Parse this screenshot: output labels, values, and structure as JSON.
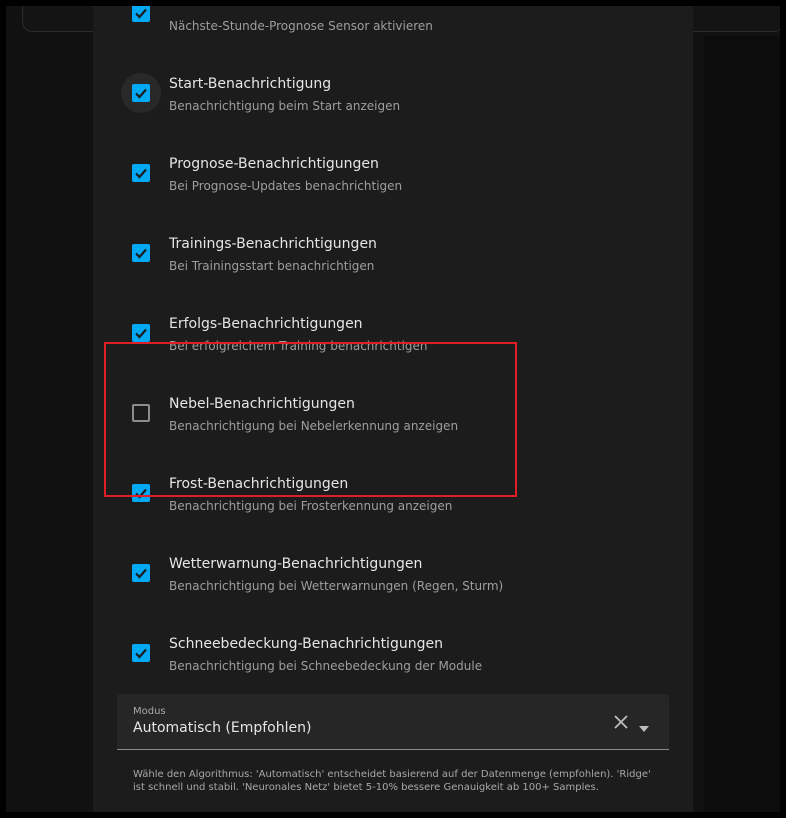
{
  "options": [
    {
      "label": "",
      "description": "Nächste-Stunde-Prognose Sensor aktivieren",
      "checked": true
    },
    {
      "label": "Start-Benachrichtigung",
      "description": "Benachrichtigung beim Start anzeigen",
      "checked": true
    },
    {
      "label": "Prognose-Benachrichtigungen",
      "description": "Bei Prognose-Updates benachrichtigen",
      "checked": true
    },
    {
      "label": "Trainings-Benachrichtigungen",
      "description": "Bei Trainingsstart benachrichtigen",
      "checked": true
    },
    {
      "label": "Erfolgs-Benachrichtigungen",
      "description": "Bei erfolgreichem Training benachrichtigen",
      "checked": true
    },
    {
      "label": "Nebel-Benachrichtigungen",
      "description": "Benachrichtigung bei Nebelerkennung anzeigen",
      "checked": false
    },
    {
      "label": "Frost-Benachrichtigungen",
      "description": "Benachrichtigung bei Frosterkennung anzeigen",
      "checked": true
    },
    {
      "label": "Wetterwarnung-Benachrichtigungen",
      "description": "Benachrichtigung bei Wetterwarnungen (Regen, Sturm)",
      "checked": true
    },
    {
      "label": "Schneebedeckung-Benachrichtigungen",
      "description": "Benachrichtigung bei Schneebedeckung der Module",
      "checked": true
    }
  ],
  "mode_select": {
    "label": "Modus",
    "value": "Automatisch (Empfohlen)",
    "helper": "Wähle den Algorithmus: 'Automatisch' entscheidet basierend auf der Datenmenge (empfohlen). 'Ridge' ist schnell und stabil. 'Neuronales Netz' bietet 5-10% bessere Genauigkeit ab 100+ Samples."
  },
  "colors": {
    "accent": "#03a9f4",
    "highlight": "#e01e26"
  },
  "icons": {
    "check": "checkmark-icon",
    "clear": "close-icon",
    "dropdown": "caret-down-icon"
  }
}
